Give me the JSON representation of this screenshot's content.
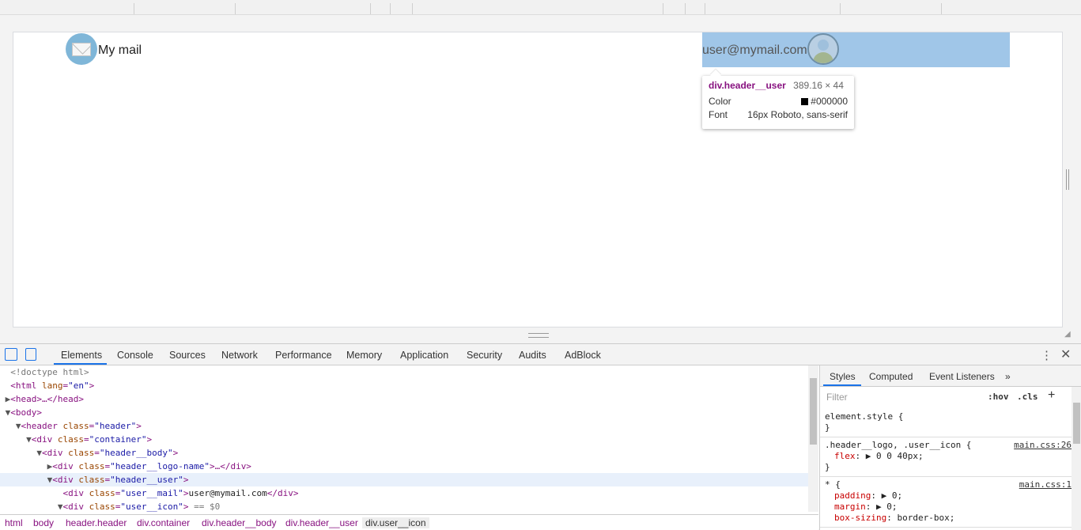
{
  "page": {
    "logo_name": "My mail",
    "user_mail": "user@mymail.com"
  },
  "tooltip": {
    "selector": "div.header__user",
    "size": "389.16 × 44",
    "color_label": "Color",
    "color_value": "#000000",
    "font_label": "Font",
    "font_value": "16px Roboto, sans-serif"
  },
  "devtools": {
    "tabs": [
      "Elements",
      "Console",
      "Sources",
      "Network",
      "Performance",
      "Memory",
      "Application",
      "Security",
      "Audits",
      "AdBlock"
    ],
    "dom_lines": [
      {
        "indent": 1,
        "tri": "",
        "html": "<span class=\"comment\">&lt;!doctype html&gt;</span>"
      },
      {
        "indent": 1,
        "tri": "",
        "html": "&lt;html <span class=\"attr\">lang</span>=<span class=\"val\">\"en\"</span>&gt;"
      },
      {
        "indent": 1,
        "tri": "▶",
        "html": "&lt;head&gt;…&lt;/head&gt;"
      },
      {
        "indent": 1,
        "tri": "▼",
        "html": "&lt;body&gt;"
      },
      {
        "indent": 2,
        "tri": "▼",
        "html": "&lt;header <span class=\"attr\">class</span>=<span class=\"val\">\"header\"</span>&gt;"
      },
      {
        "indent": 3,
        "tri": "▼",
        "html": "&lt;div <span class=\"attr\">class</span>=<span class=\"val\">\"container\"</span>&gt;"
      },
      {
        "indent": 4,
        "tri": "▼",
        "html": "&lt;div <span class=\"attr\">class</span>=<span class=\"val\">\"header__body\"</span>&gt;"
      },
      {
        "indent": 5,
        "tri": "▶",
        "html": "&lt;div <span class=\"attr\">class</span>=<span class=\"val\">\"header__logo-name\"</span>&gt;…&lt;/div&gt;"
      },
      {
        "indent": 5,
        "tri": "▼",
        "html": "&lt;div <span class=\"attr\">class</span>=<span class=\"val\">\"header__user\"</span>&gt;",
        "sel": true
      },
      {
        "indent": 6,
        "tri": "",
        "html": "&lt;div <span class=\"attr\">class</span>=<span class=\"val\">\"user__mail\"</span>&gt;<span class=\"txt\">user@mymail.com</span>&lt;/div&gt;"
      },
      {
        "indent": 6,
        "tri": "▼",
        "html": "&lt;div <span class=\"attr\">class</span>=<span class=\"val\">\"user__icon\"</span>&gt; <span class=\"comment\">== $0</span>"
      }
    ],
    "breadcrumbs": [
      "html",
      "body",
      "header.header",
      "div.container",
      "div.header__body",
      "div.header__user",
      "div.user__icon"
    ],
    "styles_tabs": [
      "Styles",
      "Computed",
      "Event Listeners"
    ],
    "filter_placeholder": "Filter",
    "hov": ":hov",
    "cls": ".cls",
    "rules": [
      {
        "selector": "element.style {",
        "source": "",
        "props": [],
        "close": "}"
      },
      {
        "selector": ".header__logo, .user__icon {",
        "source": "main.css:26",
        "props": [
          {
            "name": "flex",
            "value": "▶ 0 0 40px;"
          }
        ],
        "close": "}"
      },
      {
        "selector": "* {",
        "source": "main.css:1",
        "props": [
          {
            "name": "padding",
            "value": "▶ 0;"
          },
          {
            "name": "margin",
            "value": "▶ 0;"
          },
          {
            "name": "box-sizing",
            "value": "border-box;"
          }
        ],
        "close": ""
      }
    ]
  }
}
